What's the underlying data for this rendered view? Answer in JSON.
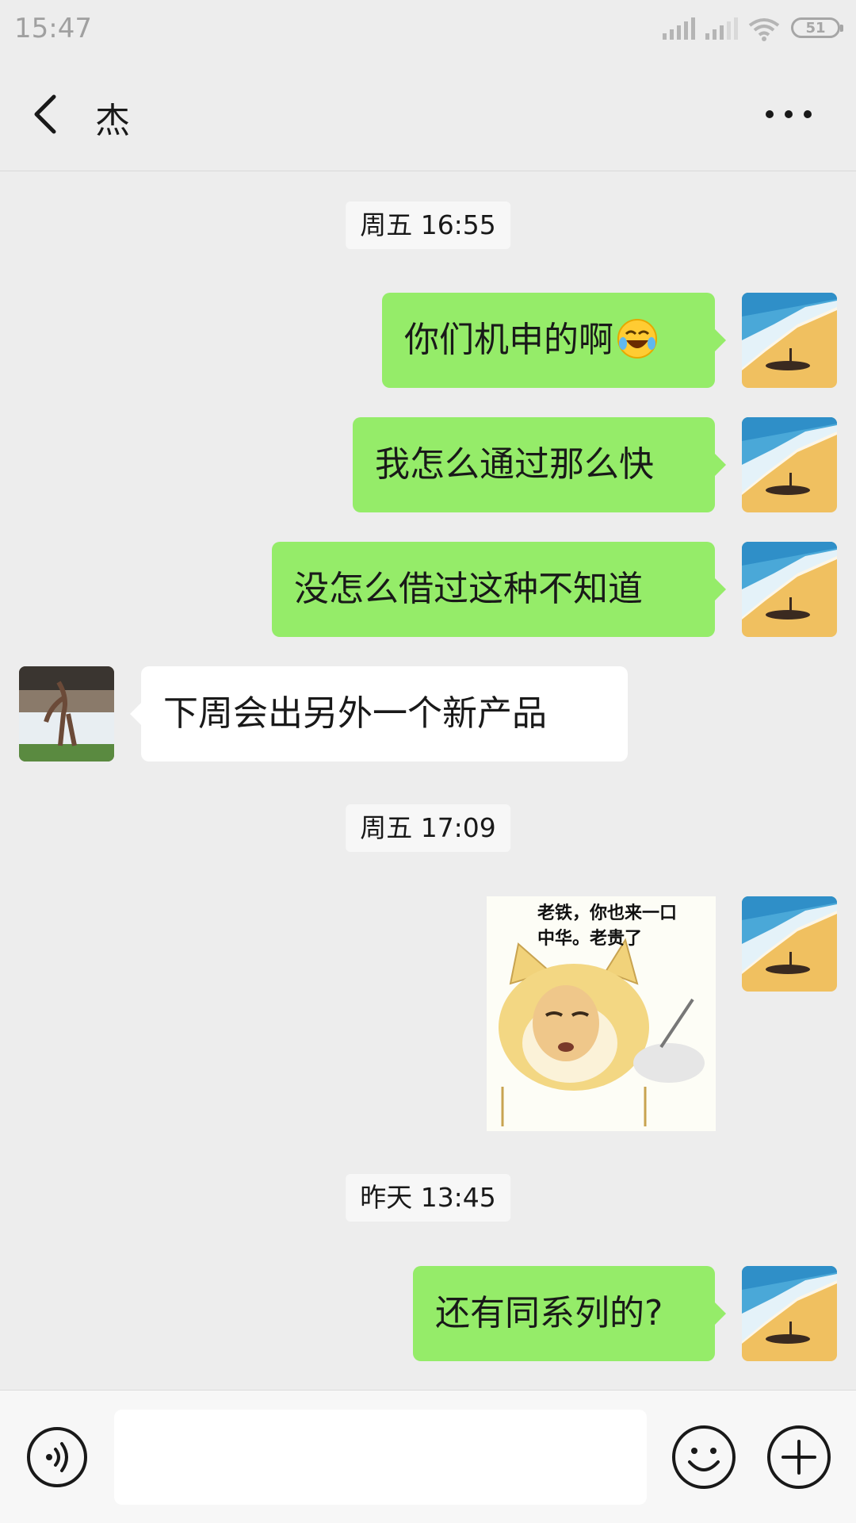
{
  "status_bar": {
    "time": "15:47",
    "battery": "51",
    "icons": [
      "signal-icon",
      "signal-icon-2",
      "wifi-icon",
      "battery-icon"
    ]
  },
  "nav": {
    "back_icon": "back-chevron-icon",
    "title": "杰",
    "more_icon": "more-dots-icon"
  },
  "timestamps": [
    "周五 16:55",
    "周五 17:09",
    "昨天 13:45"
  ],
  "messages": [
    {
      "from": "me",
      "text": "你们机申的啊",
      "emoji": "crying-laughing-emoji"
    },
    {
      "from": "me",
      "text": "我怎么通过那么快"
    },
    {
      "from": "me",
      "text": "没怎么借过这种不知道"
    },
    {
      "from": "other",
      "text": "下周会出另外一个新产品"
    },
    {
      "from": "me",
      "type": "sticker",
      "caption": "老铁，你也来一口\n中华。老贵了"
    },
    {
      "from": "me",
      "text": "还有同系列的?"
    }
  ],
  "input_bar": {
    "voice_icon": "voice-icon",
    "value": "",
    "emoji_icon": "emoji-icon",
    "plus_icon": "plus-icon"
  },
  "colors": {
    "background": "#ededed",
    "my_bubble": "#95ec69",
    "their_bubble": "#ffffff"
  }
}
